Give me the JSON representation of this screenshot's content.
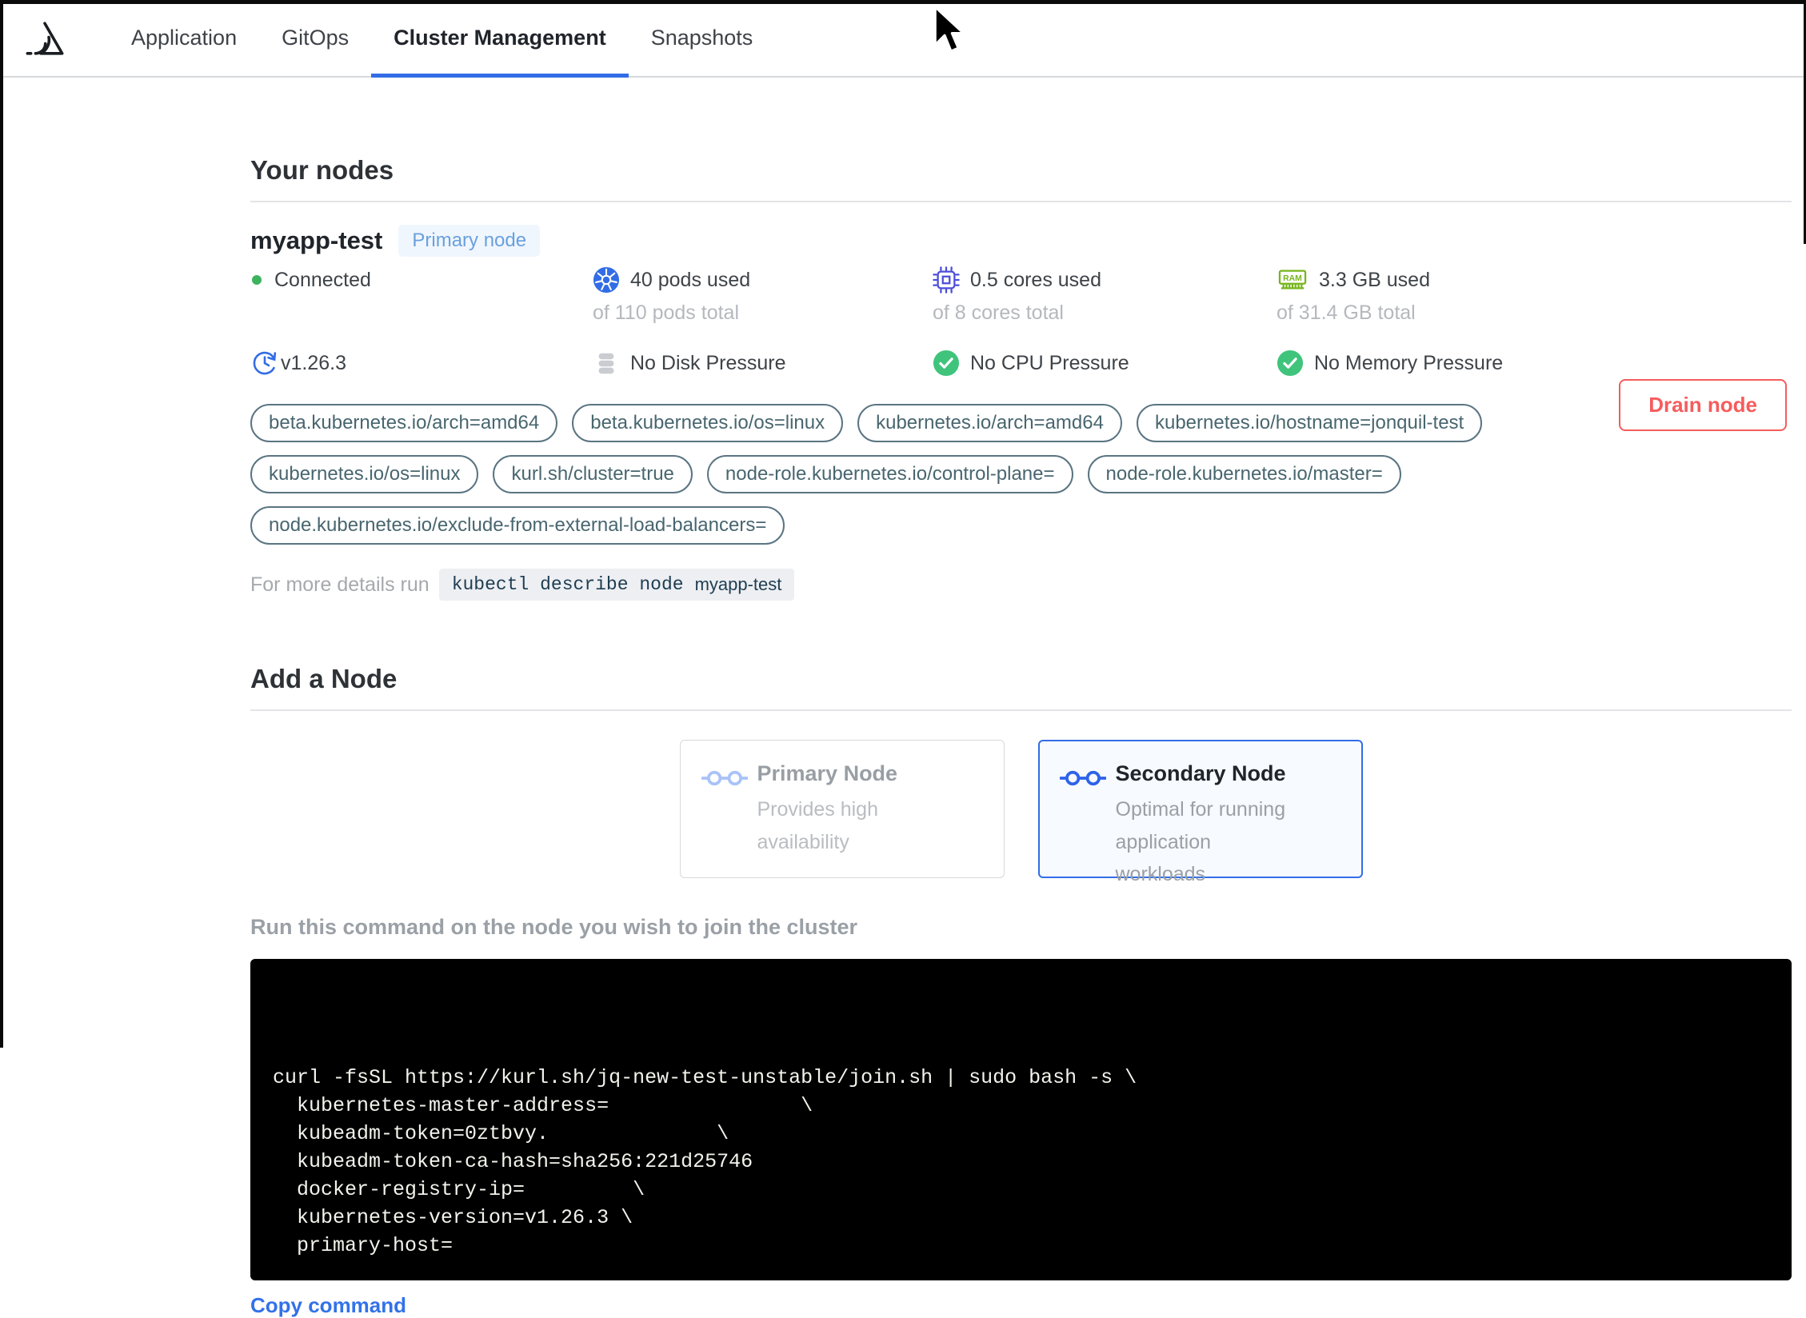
{
  "nav": {
    "tabs": [
      {
        "label": "Application",
        "active": false
      },
      {
        "label": "GitOps",
        "active": false
      },
      {
        "label": "Cluster Management",
        "active": true
      },
      {
        "label": "Snapshots",
        "active": false
      }
    ]
  },
  "your_nodes": {
    "title": "Your nodes",
    "node": {
      "name": "myapp-test",
      "badge": "Primary node",
      "status": "Connected",
      "version": "v1.26.3",
      "pods_used": "40 pods used",
      "pods_total": "of 110 pods total",
      "cores_used": "0.5 cores used",
      "cores_total": "of 8 cores total",
      "memory_used": "3.3 GB used",
      "memory_total": "of 31.4 GB total",
      "disk_pressure": "No Disk Pressure",
      "cpu_pressure": "No CPU Pressure",
      "memory_pressure": "No Memory Pressure",
      "labels": [
        "beta.kubernetes.io/arch=amd64",
        "beta.kubernetes.io/os=linux",
        "kubernetes.io/arch=amd64",
        "kubernetes.io/hostname=jonquil-test",
        "kubernetes.io/os=linux",
        "kurl.sh/cluster=true",
        "node-role.kubernetes.io/control-plane=",
        "node-role.kubernetes.io/master=",
        "node.kubernetes.io/exclude-from-external-load-balancers="
      ],
      "details_prefix": "For more details run",
      "details_command": "kubectl describe node",
      "details_node": "myapp-test",
      "drain_label": "Drain node"
    }
  },
  "add_node": {
    "title": "Add a Node",
    "options": [
      {
        "title": "Primary Node",
        "description": "Provides high availability",
        "selected": false
      },
      {
        "title": "Secondary Node",
        "description": "Optimal for running application workloads",
        "selected": true
      }
    ],
    "instruction": "Run this command on the node you wish to join the cluster",
    "command_lines": [
      "curl -fsSL https://kurl.sh/jq-new-test-unstable/join.sh | sudo bash -s \\",
      "  kubernetes-master-address=                \\",
      "  kubeadm-token=0ztbvy.              \\",
      "  kubeadm-token-ca-hash=sha256:221d25746",
      "  docker-registry-ip=         \\",
      "  kubernetes-version=v1.26.3 \\",
      "  primary-host="
    ],
    "copy_label": "Copy command"
  },
  "icons": {
    "ram_text": "RAM"
  },
  "colors": {
    "accent_blue": "#326de6",
    "danger_red": "#f65c5c",
    "success_green": "#40c47c",
    "status_dot_green": "#3db35f",
    "ram_green": "#76b51b",
    "cpu_indigo": "#4b4dd8",
    "pill_teal": "#5a7482",
    "link_blue": "#3272e8"
  }
}
